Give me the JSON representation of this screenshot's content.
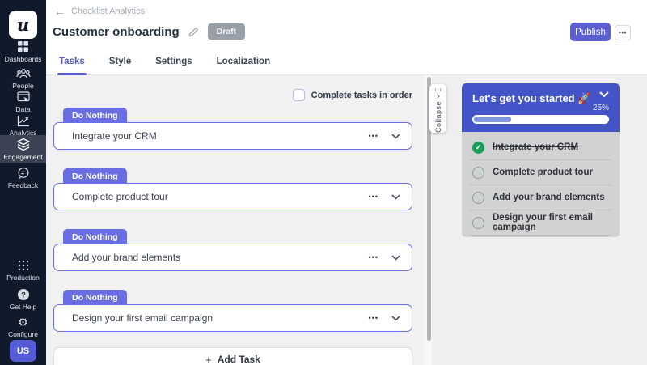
{
  "sidebar": {
    "logo_letter": "u",
    "items": [
      {
        "label": "Dashboards"
      },
      {
        "label": "People"
      },
      {
        "label": "Data"
      },
      {
        "label": "Analytics"
      },
      {
        "label": "Engagement",
        "active": true
      },
      {
        "label": "Feedback"
      }
    ],
    "footer_items": [
      {
        "label": "Production"
      },
      {
        "label": "Get Help"
      },
      {
        "label": "Configure"
      }
    ],
    "help_glyph": "?",
    "avatar_initials": "US"
  },
  "header": {
    "back_arrow": "←",
    "back_label": "Checklist Analytics",
    "title": "Customer onboarding",
    "status_badge": "Draft",
    "publish_label": "Publish",
    "more_label": "•••"
  },
  "tabs": {
    "items": [
      {
        "label": "Tasks",
        "active": true
      },
      {
        "label": "Style"
      },
      {
        "label": "Settings"
      },
      {
        "label": "Localization"
      }
    ]
  },
  "content": {
    "order_checkbox_label": "Complete tasks in order",
    "order_checkbox_checked": false,
    "task_menu_glyph": "•••",
    "tasks": [
      {
        "action_label": "Do Nothing",
        "title": "Integrate your CRM"
      },
      {
        "action_label": "Do Nothing",
        "title": "Complete product tour"
      },
      {
        "action_label": "Do Nothing",
        "title": "Add your brand elements"
      },
      {
        "action_label": "Do Nothing",
        "title": "Design your first email campaign"
      }
    ],
    "add_task_plus": "+",
    "add_task_label": "Add Task"
  },
  "splitter": {
    "collapse_label": "Collapse"
  },
  "preview": {
    "title": "Let's get you started 🚀",
    "progress_label": "25%",
    "progress_value": 27,
    "check_glyph": "✓",
    "items": [
      {
        "label": "Integrate your CRM",
        "completed": true
      },
      {
        "label": "Complete product tour",
        "completed": false
      },
      {
        "label": "Add your brand elements",
        "completed": false
      },
      {
        "label": "Design your first email campaign",
        "completed": false
      }
    ]
  },
  "colors": {
    "sidebar_bg": "#101a2b",
    "primary_purple": "#6a6ee4",
    "publish_purple": "#5b5fd1",
    "active_tab_purple": "#5558c5",
    "preview_header_blue": "#4353c8",
    "progress_fill": "#8094de",
    "success_green": "#1b9e57",
    "draft_badge_bg": "#9aa0a9",
    "content_bg": "#f2f1f2",
    "panel_body_bg": "#d2d2d3"
  }
}
